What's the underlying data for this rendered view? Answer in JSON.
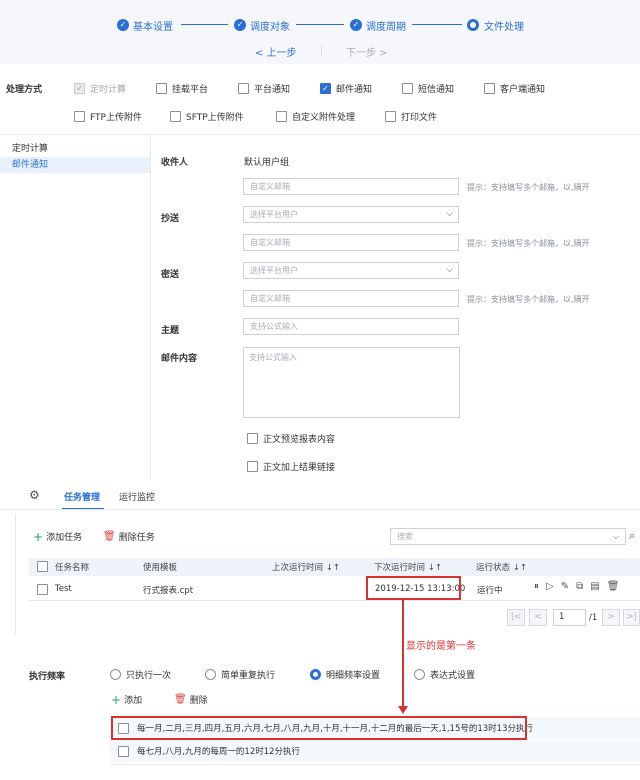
{
  "steps": [
    {
      "label": "基本设置",
      "state": "done"
    },
    {
      "label": "调度对象",
      "state": "done"
    },
    {
      "label": "调度周期",
      "state": "done"
    },
    {
      "label": "文件处理",
      "state": "current"
    }
  ],
  "nav": {
    "prev": "< 上一步",
    "next": "下一步 >"
  },
  "processing": {
    "label": "处理方式",
    "options": [
      {
        "label": "定时计算",
        "checked": true,
        "disabled": true
      },
      {
        "label": "挂载平台",
        "checked": false
      },
      {
        "label": "平台通知",
        "checked": false
      },
      {
        "label": "邮件通知",
        "checked": true
      },
      {
        "label": "短信通知",
        "checked": false
      },
      {
        "label": "客户端通知",
        "checked": false
      },
      {
        "label": "FTP上传附件",
        "checked": false
      },
      {
        "label": "SFTP上传附件",
        "checked": false
      },
      {
        "label": "自定义附件处理",
        "checked": false
      },
      {
        "label": "打印文件",
        "checked": false
      }
    ]
  },
  "side_menu": [
    {
      "label": "定时计算",
      "active": false
    },
    {
      "label": "邮件通知",
      "active": true
    }
  ],
  "email_form": {
    "recipient_label": "收件人",
    "recipient_value": "默认用户组",
    "recipient_placeholder": "自定义邮箱",
    "hint": "提示：支持填写多个邮箱，以,隔开",
    "cc_label": "抄送",
    "cc_select": "选择平台用户",
    "cc_placeholder": "自定义邮箱",
    "bcc_label": "密送",
    "bcc_select": "选择平台用户",
    "bcc_placeholder": "自定义邮箱",
    "subject_label": "主题",
    "subject_placeholder": "支持公式输入",
    "content_label": "邮件内容",
    "content_placeholder": "支持公式输入",
    "opt_preview": "正文预览报表内容",
    "opt_link": "正文加上结果链接"
  },
  "tabs": [
    {
      "label": "任务管理",
      "active": true
    },
    {
      "label": "运行监控",
      "active": false
    }
  ],
  "toolbar": {
    "add": "添加任务",
    "delete": "删除任务",
    "search_placeholder": "搜索"
  },
  "table": {
    "headers": [
      "任务名称",
      "使用模板",
      "上次运行时间 ↓↑",
      "下次运行时间 ↓↑",
      "运行状态 ↓↑"
    ],
    "rows": [
      {
        "name": "Test",
        "template": "行式报表.cpt",
        "last": "",
        "next": "2019-12-15 13:13:00",
        "status": "运行中"
      }
    ]
  },
  "pagination": {
    "page": "1",
    "total": "/1"
  },
  "annotation": "显示的是第一条",
  "frequency": {
    "label": "执行频率",
    "options": [
      {
        "label": "只执行一次",
        "selected": false
      },
      {
        "label": "简单重复执行",
        "selected": false
      },
      {
        "label": "明细频率设置",
        "selected": true
      },
      {
        "label": "表达式设置",
        "selected": false
      }
    ],
    "add": "添加",
    "delete": "删除",
    "rules": [
      "每一月,二月,三月,四月,五月,六月,七月,八月,九月,十月,十一月,十二月的最后一天,1,15号的13时13分执行",
      "每七月,八月,九月的每周一的12时12分执行"
    ]
  },
  "colors": {
    "accent": "#2a6fd6",
    "annotation": "#d9322e"
  }
}
